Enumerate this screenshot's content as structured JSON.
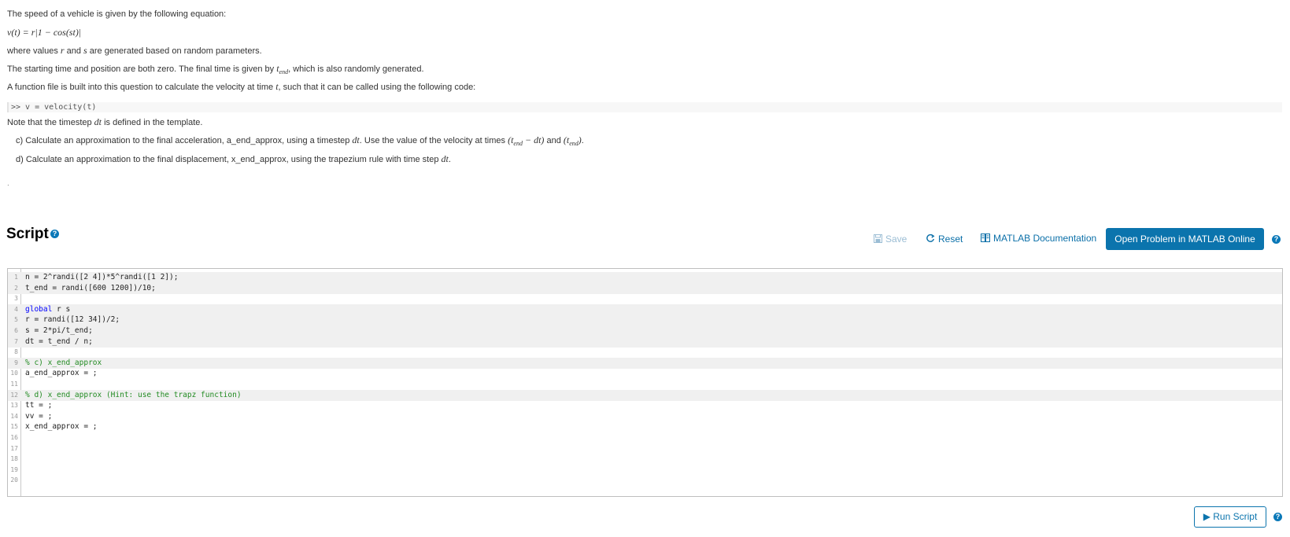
{
  "problem": {
    "p1": "The speed of a vehicle is given by the following equation:",
    "equation": "v(t) = r|1 − cos(st)|",
    "p2_pre": "where values ",
    "p2_r": "r",
    "p2_and": " and ",
    "p2_s": "s",
    "p2_post": " are generated based on random parameters.",
    "p3_pre": "The starting time and position are both zero. The final time is given by ",
    "p3_tend": "t",
    "p3_sub": "end",
    "p3_post": ", which is also randomly generated.",
    "p4_pre": "A function file is built into this question to calculate the velocity at time ",
    "p4_t": "t",
    "p4_post": ", such that it can be called using the following code:",
    "code_sample": ">> v = velocity(t)",
    "p5_pre": "Note that the timestep ",
    "p5_dt": "dt",
    "p5_post": " is  defined in the template.",
    "c_pre": "c) Calculate an approximation to the final acceleration, a_end_approx, using a timestep ",
    "c_dt": "dt",
    "c_mid": ". Use the value of the velocity at times ",
    "c_times1": "(t",
    "c_times1b": "end",
    "c_times1c": " − dt)",
    "c_and": " and ",
    "c_times2": "(t",
    "c_times2b": "end",
    "c_times2c": ")",
    "c_end": ".",
    "d_pre": "d) Calculate an approximation to the final displacement, x_end_approx, using the trapezium rule with time step ",
    "d_dt": "dt",
    "d_end": ".",
    "dot": "."
  },
  "script": {
    "title": "Script",
    "save_label": "Save",
    "reset_label": "Reset",
    "doc_label": "MATLAB Documentation",
    "open_label": "Open Problem in MATLAB Online",
    "run_label": "Run Script",
    "help_glyph": "?"
  },
  "editor": {
    "lines": [
      {
        "n": "1",
        "code": "n = 2^randi([2 4])*5^randi([1 2]);"
      },
      {
        "n": "2",
        "code": "t_end = randi([600 1200])/10;"
      },
      {
        "n": "3",
        "code": ""
      },
      {
        "n": "4",
        "kw": "global",
        "code": " r s"
      },
      {
        "n": "5",
        "code": "r = randi([12 34])/2;"
      },
      {
        "n": "6",
        "code": "s = 2*pi/t_end;"
      },
      {
        "n": "7",
        "code": "dt = t_end / n;"
      },
      {
        "n": "8",
        "code": ""
      },
      {
        "n": "9",
        "comment": "% c) x_end_approx"
      },
      {
        "n": "10",
        "code": "a_end_approx = ;"
      },
      {
        "n": "11",
        "code": ""
      },
      {
        "n": "12",
        "comment": "% d) x_end_approx (Hint: use the trapz function)"
      },
      {
        "n": "13",
        "code": "tt = ;"
      },
      {
        "n": "14",
        "code": "vv = ;"
      },
      {
        "n": "15",
        "code": "x_end_approx = ;"
      },
      {
        "n": "16",
        "code": ""
      },
      {
        "n": "17",
        "code": ""
      },
      {
        "n": "18",
        "code": ""
      },
      {
        "n": "19",
        "code": ""
      },
      {
        "n": "20",
        "code": ""
      }
    ]
  }
}
